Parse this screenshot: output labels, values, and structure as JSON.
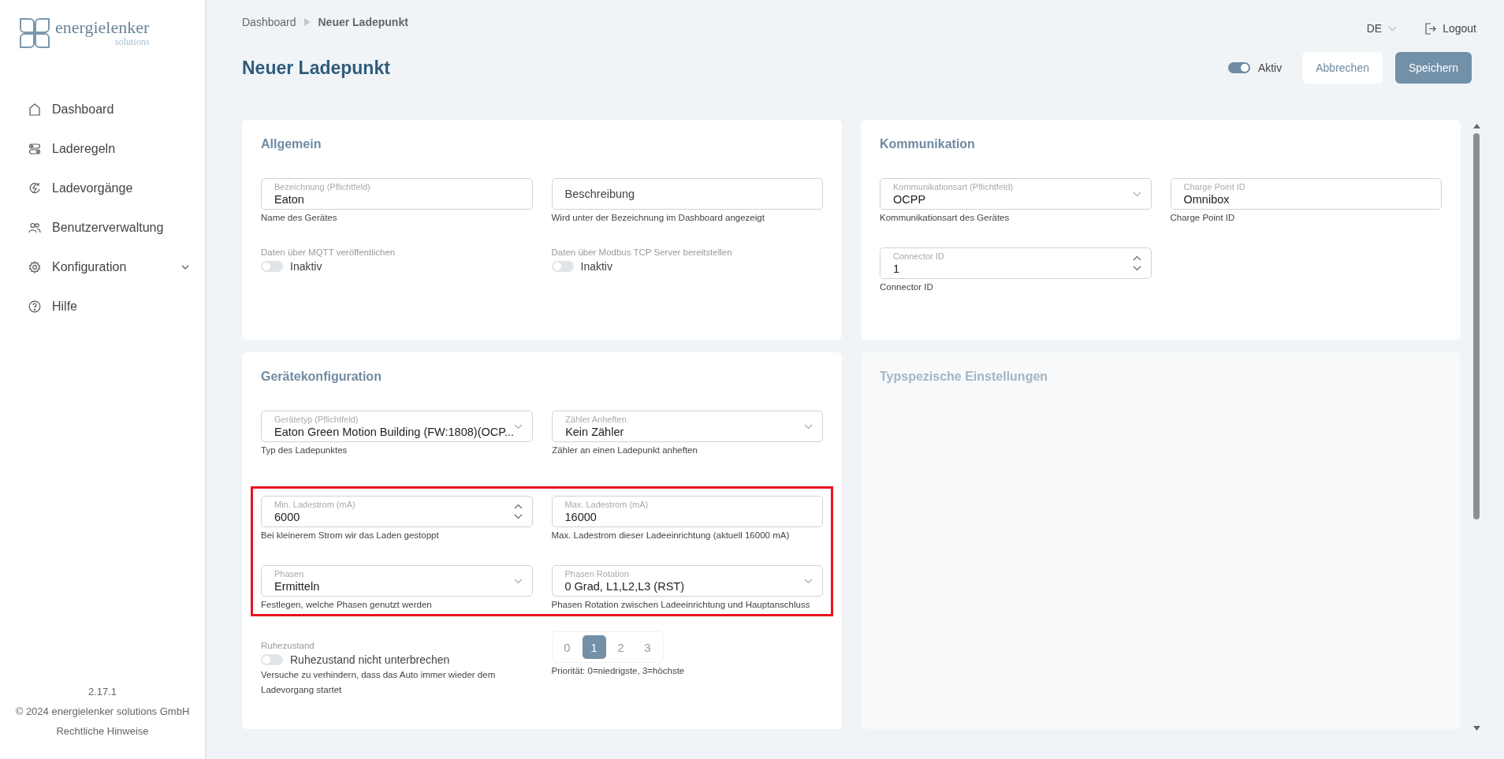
{
  "logo": {
    "name": "energielenker",
    "tagline": "solutions"
  },
  "sidebar": {
    "items": [
      {
        "label": "Dashboard",
        "expandable": false
      },
      {
        "label": "Laderegeln",
        "expandable": false
      },
      {
        "label": "Ladevorgänge",
        "expandable": false
      },
      {
        "label": "Benutzerverwaltung",
        "expandable": false
      },
      {
        "label": "Konfiguration",
        "expandable": true
      },
      {
        "label": "Hilfe",
        "expandable": false
      }
    ],
    "version": "2.17.1",
    "copyright": "© 2024 energielenker solutions GmbH",
    "legal_link": "Rechtliche Hinweise"
  },
  "breadcrumb": [
    "Dashboard",
    "Neuer Ladepunkt"
  ],
  "language": "DE",
  "logout": "Logout",
  "title": "Neuer Ladepunkt",
  "active_toggle": {
    "on": true,
    "label": "Aktiv"
  },
  "buttons": {
    "cancel": "Abbrechen",
    "save": "Speichern"
  },
  "cards": [
    {
      "title": "Allgemein",
      "disabled": false,
      "groups": [
        {
          "highlighted": false,
          "rows": [
            [
              {
                "kind": "text",
                "label": "Bezeichnung (Pflichtfeld)",
                "value": "Eaton",
                "hint": "Name des Gerätes"
              },
              {
                "kind": "text",
                "placeholder": "Beschreibung",
                "hint": "Wird unter der Bezeichnung im Dashboard angezeigt"
              }
            ],
            [
              {
                "kind": "toggle",
                "label": "Daten über MQTT veröffentlichen",
                "on": false,
                "text": "Inaktiv"
              },
              {
                "kind": "toggle",
                "label": "Daten über Modbus TCP Server bereitstellen",
                "on": false,
                "text": "Inaktiv"
              }
            ]
          ]
        }
      ]
    },
    {
      "title": "Kommunikation",
      "disabled": false,
      "groups": [
        {
          "highlighted": false,
          "rows": [
            [
              {
                "kind": "select",
                "label": "Kommunikationsart (Pflichtfeld)",
                "value": "OCPP",
                "hint": "Kommunikationsart des Gerätes"
              },
              {
                "kind": "text",
                "label": "Charge Point ID",
                "value": "Omnibox",
                "hint": "Charge Point ID"
              }
            ],
            [
              {
                "kind": "number",
                "label": "Connector ID",
                "value": "1",
                "hint": "Connector ID"
              }
            ]
          ]
        }
      ]
    },
    {
      "title": "Gerätekonfiguration",
      "disabled": false,
      "groups": [
        {
          "highlighted": false,
          "rows": [
            [
              {
                "kind": "select",
                "label": "Gerätetyp (Pflichtfeld)",
                "value": "Eaton Green Motion Building (FW:1808)(OCP...",
                "hint": "Typ des Ladepunktes"
              },
              {
                "kind": "select",
                "label": "Zähler Anheften",
                "value": "Kein Zähler",
                "hint": "Zähler an einen Ladepunkt anheften"
              }
            ]
          ]
        },
        {
          "highlighted": true,
          "rows": [
            [
              {
                "kind": "number",
                "label": "Min. Ladestrom (mA)",
                "value": "6000",
                "hint": "Bei kleinerem Strom wir das Laden gestoppt"
              },
              {
                "kind": "text",
                "label": "Max. Ladestrom (mA)",
                "value": "16000",
                "hint": "Max. Ladestrom dieser Ladeeinrichtung (aktuell 16000 mA)"
              }
            ],
            [
              {
                "kind": "select",
                "label": "Phasen",
                "value": "Ermitteln",
                "hint": "Festlegen, welche Phasen genutzt werden"
              },
              {
                "kind": "select",
                "label": "Phasen Rotation",
                "value": "0 Grad, L1,L2,L3 (RST)",
                "hint": "Phasen Rotation zwischen Ladeeinrichtung und Hauptanschluss"
              }
            ]
          ]
        },
        {
          "highlighted": false,
          "rows": [
            [
              {
                "kind": "toggle",
                "label": "Ruhezustand",
                "on": false,
                "text": "Ruhezustand nicht unterbrechen",
                "hint": "Versuche zu verhindern, dass das Auto immer wieder dem Ladevorgang startet"
              },
              {
                "kind": "segmented",
                "options": [
                  {
                    "label": "0",
                    "selected": false
                  },
                  {
                    "label": "1",
                    "selected": true
                  },
                  {
                    "label": "2",
                    "selected": false
                  },
                  {
                    "label": "3",
                    "selected": false
                  }
                ],
                "hint": "Priorität: 0=niedrigste, 3=höchste"
              }
            ]
          ]
        }
      ]
    },
    {
      "title": "Typspezische Einstellungen",
      "disabled": true
    }
  ]
}
